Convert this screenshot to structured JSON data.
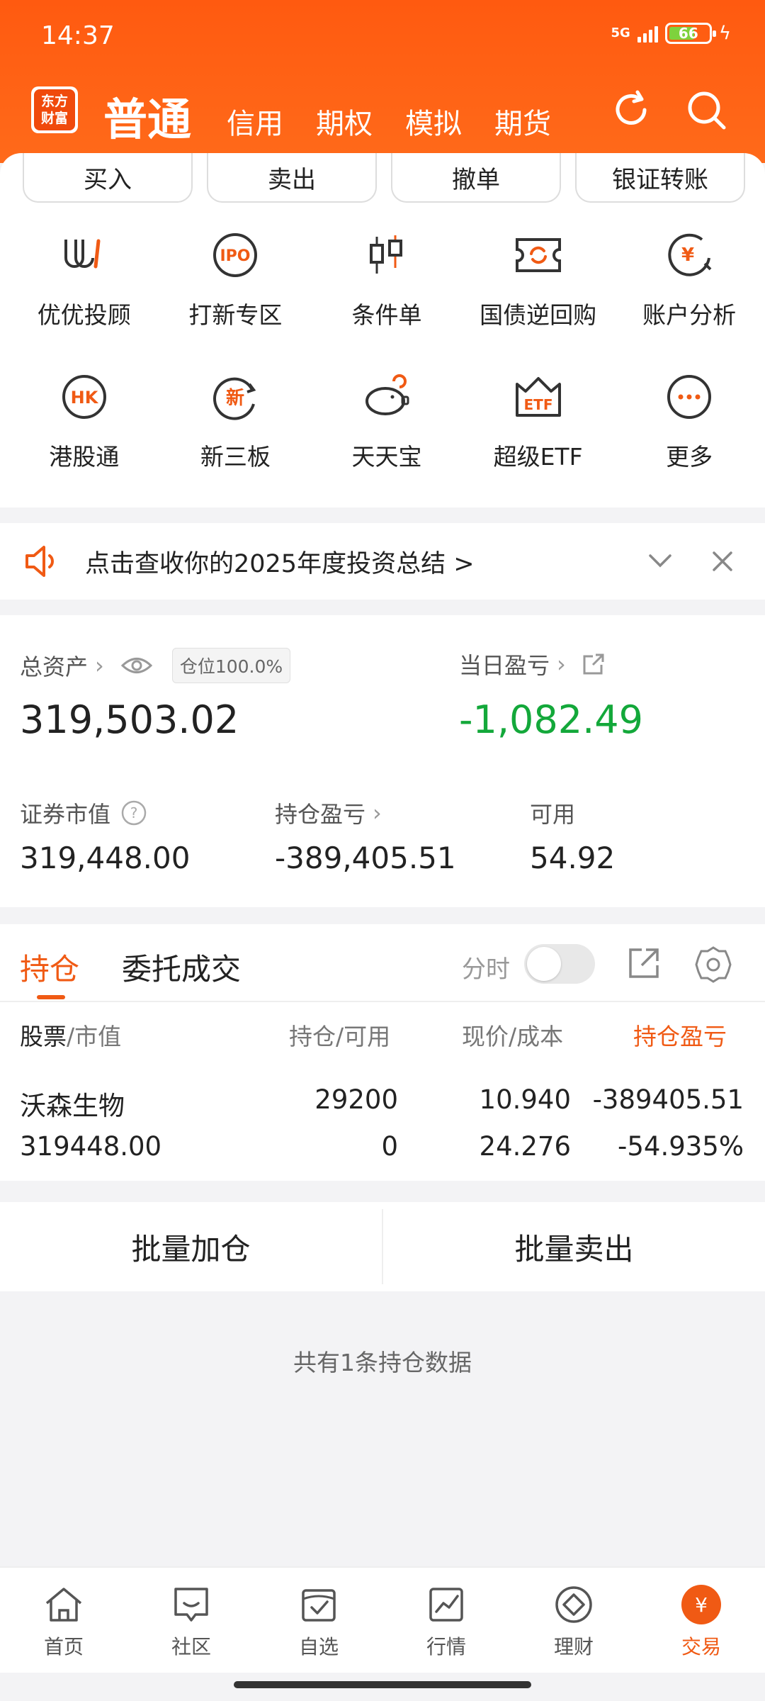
{
  "status_bar": {
    "time": "14:37",
    "network": "5G",
    "battery": "66"
  },
  "header": {
    "logo_line1": "东方",
    "logo_line2": "财富",
    "active_tab": "普通",
    "tabs": [
      "信用",
      "期权",
      "模拟",
      "期货"
    ]
  },
  "actions": [
    "买入",
    "卖出",
    "撤单",
    "银证转账"
  ],
  "features": {
    "row1": [
      {
        "label": "优优投顾",
        "icon": "uu-advisor-icon"
      },
      {
        "label": "打新专区",
        "icon": "ipo-icon"
      },
      {
        "label": "条件单",
        "icon": "condition-order-icon"
      },
      {
        "label": "国债逆回购",
        "icon": "reverse-repo-icon"
      },
      {
        "label": "账户分析",
        "icon": "account-analysis-icon"
      }
    ],
    "row2": [
      {
        "label": "港股通",
        "icon": "hk-connect-icon"
      },
      {
        "label": "新三板",
        "icon": "neeq-icon"
      },
      {
        "label": "天天宝",
        "icon": "piggy-bank-icon"
      },
      {
        "label": "超级ETF",
        "icon": "etf-icon"
      },
      {
        "label": "更多",
        "icon": "more-icon"
      }
    ]
  },
  "notice": {
    "text": "点击查收你的2025年度投资总结 >"
  },
  "assets": {
    "total_label": "总资产",
    "position_pct": "仓位100.0%",
    "total_value": "319,503.02",
    "daily_pl_label": "当日盈亏",
    "daily_pl_value": "-1,082.49",
    "market_value_label": "证券市值",
    "market_value": "319,448.00",
    "holding_pl_label": "持仓盈亏",
    "holding_pl": "-389,405.51",
    "available_label": "可用",
    "available": "54.92"
  },
  "holdings": {
    "tab_active": "持仓",
    "tab_other": "委托成交",
    "timeshare_label": "分时",
    "headers": {
      "stock": "股票",
      "stock_sub": "/市值",
      "position": "持仓/可用",
      "price": "现价/成本",
      "pl": "持仓盈亏"
    },
    "rows": [
      {
        "name": "沃森生物",
        "market_value": "319448.00",
        "position": "29200",
        "available": "0",
        "price": "10.940",
        "cost": "24.276",
        "pl": "-389405.51",
        "pl_pct": "-54.935%"
      }
    ]
  },
  "bulk": {
    "add": "批量加仓",
    "sell": "批量卖出"
  },
  "count_text": "共有1条持仓数据",
  "nav": [
    {
      "label": "首页",
      "icon": "home-icon"
    },
    {
      "label": "社区",
      "icon": "community-icon"
    },
    {
      "label": "自选",
      "icon": "watchlist-icon"
    },
    {
      "label": "行情",
      "icon": "market-icon"
    },
    {
      "label": "理财",
      "icon": "wealth-icon"
    },
    {
      "label": "交易",
      "icon": "trade-icon"
    }
  ],
  "colors": {
    "accent": "#f05a14",
    "header": "#ff5a10",
    "gain_loss_green": "#13a83a"
  }
}
